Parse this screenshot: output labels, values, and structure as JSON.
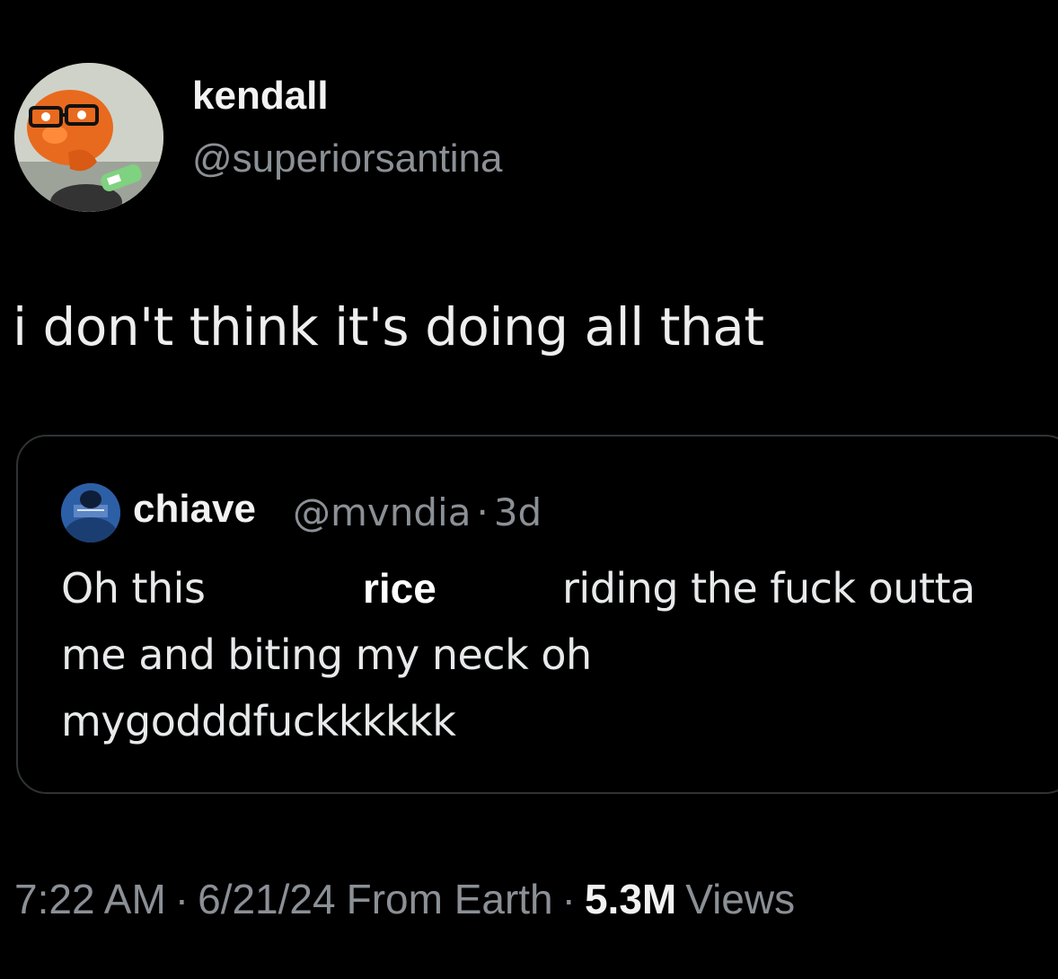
{
  "author": {
    "name": "kendall",
    "handle": "@superiorsantina"
  },
  "tweet": {
    "text": "i don't think it's doing all that"
  },
  "quoted": {
    "name": "chiave",
    "handle": "@mvndia",
    "age": "3d",
    "separator": "·",
    "line1_start": "Oh this",
    "inserted_word": "rice",
    "line1_end": "riding the fuck outta",
    "line2": "me and biting my neck oh",
    "line3": "mygodddfuckkkkkk"
  },
  "footer": {
    "time": "7:22 AM",
    "date": "6/21/24",
    "source": "From Earth",
    "views_count": "5.3M",
    "views_label": "Views",
    "separator": "·"
  },
  "colors": {
    "background": "#000000",
    "text_primary": "#e7e9ea",
    "text_secondary": "#8b9096",
    "border": "#2f3336"
  }
}
